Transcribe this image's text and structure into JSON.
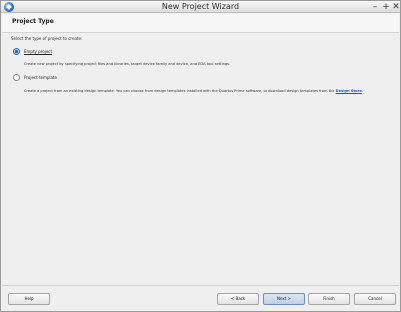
{
  "window": {
    "title": "New Project Wizard",
    "controls": {
      "minimize": "–",
      "maximize": "+",
      "close": "✕"
    }
  },
  "page": {
    "title": "Project Type",
    "instruction": "Select the type of project to create:"
  },
  "options": [
    {
      "label": "Empty project",
      "selected": true,
      "description": "Create new project by specifying project files and libraries, target device family and device, and EDA tool settings."
    },
    {
      "label": "Project template",
      "selected": false,
      "description_prefix": "Create a project from an existing design template. You can choose from design templates installed with the Quartus Prime software, or download design templates from the ",
      "description_link": "Design Store",
      "description_suffix": "."
    }
  ],
  "buttons": {
    "help": "Help",
    "back": "< Back",
    "next": "Next >",
    "finish": "Finish",
    "cancel": "Cancel"
  }
}
